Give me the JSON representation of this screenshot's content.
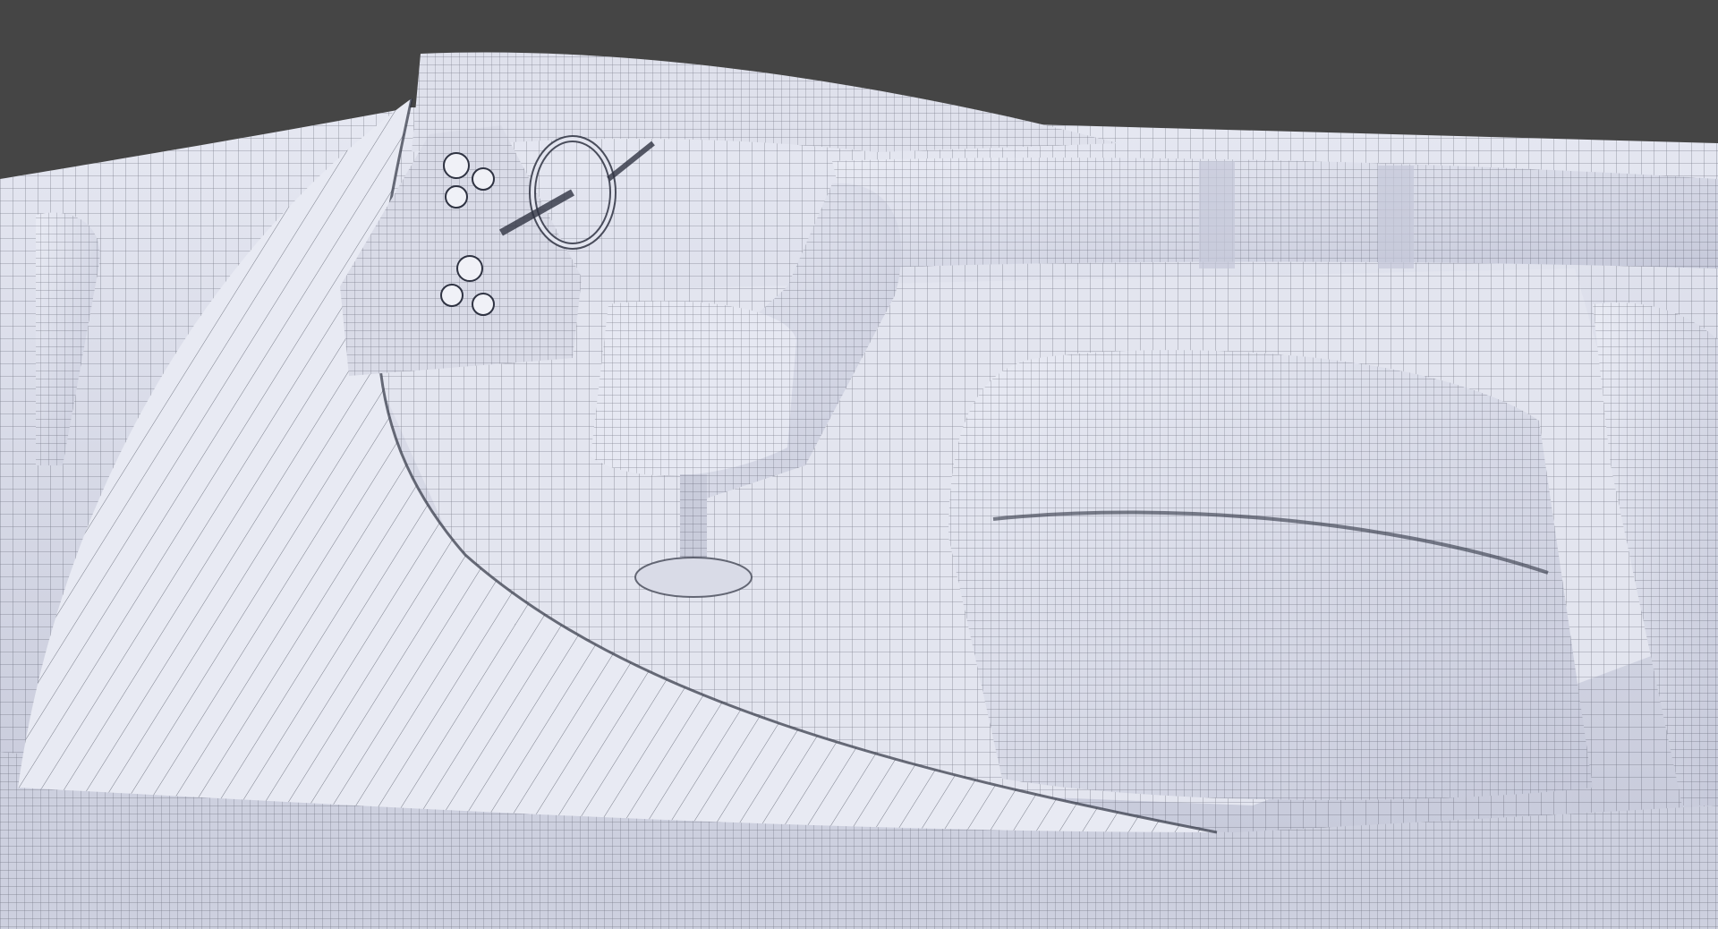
{
  "scene": {
    "subject": "wireframe-render",
    "colors": {
      "background": "#454545",
      "surface_light": "#eeeff6",
      "surface_mid": "#d4d6e4",
      "surface_shade": "#b8bbcc",
      "wire": "#2f3342"
    },
    "icons": [
      "hull-mesh",
      "windshield-mesh",
      "dashboard-mesh",
      "steering-wheel-mesh",
      "helm-seat-mesh",
      "pedestal-mesh",
      "bench-seat-mesh",
      "side-bolster-mesh"
    ]
  }
}
